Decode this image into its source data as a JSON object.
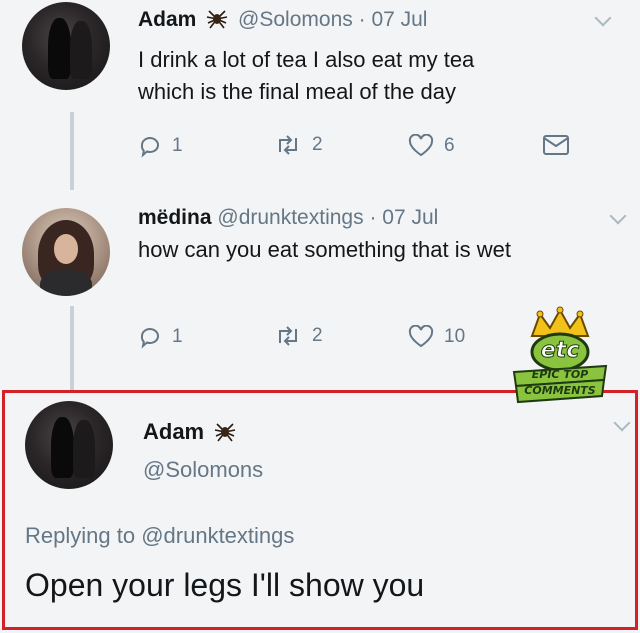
{
  "tweets": [
    {
      "name": "Adam",
      "handle": "@Solomons",
      "separator": "·",
      "date": "07 Jul",
      "text_line1": "I drink a lot of tea I also eat my tea",
      "text_line2": "which is the final meal of the day",
      "replies": "1",
      "retweets": "2",
      "likes": "6",
      "icons": [
        "reply-icon",
        "retweet-icon",
        "heart-icon",
        "message-icon",
        "spider-icon",
        "chevron-down-icon"
      ]
    },
    {
      "name": "mëdina",
      "handle": "@drunktextings",
      "separator": "·",
      "date": "07 Jul",
      "text_line1": "how can you eat something that is wet",
      "replies": "1",
      "retweets": "2",
      "likes": "10",
      "icons": [
        "reply-icon",
        "retweet-icon",
        "heart-icon",
        "chevron-down-icon"
      ]
    }
  ],
  "reply": {
    "name": "Adam",
    "handle": "@Solomons",
    "replying_prefix": "Replying to",
    "replying_handle": "@drunktextings",
    "text": "Open your legs I'll show you",
    "highlight_color": "#d42027"
  },
  "watermark": {
    "monogram": "etc",
    "line1": "EPIC TOP",
    "line2": "COMMENTS"
  },
  "colors": {
    "background": "#f3f4f5",
    "secondary_text": "#657786",
    "link": "#657786",
    "thread_line": "#c9d1d8"
  }
}
